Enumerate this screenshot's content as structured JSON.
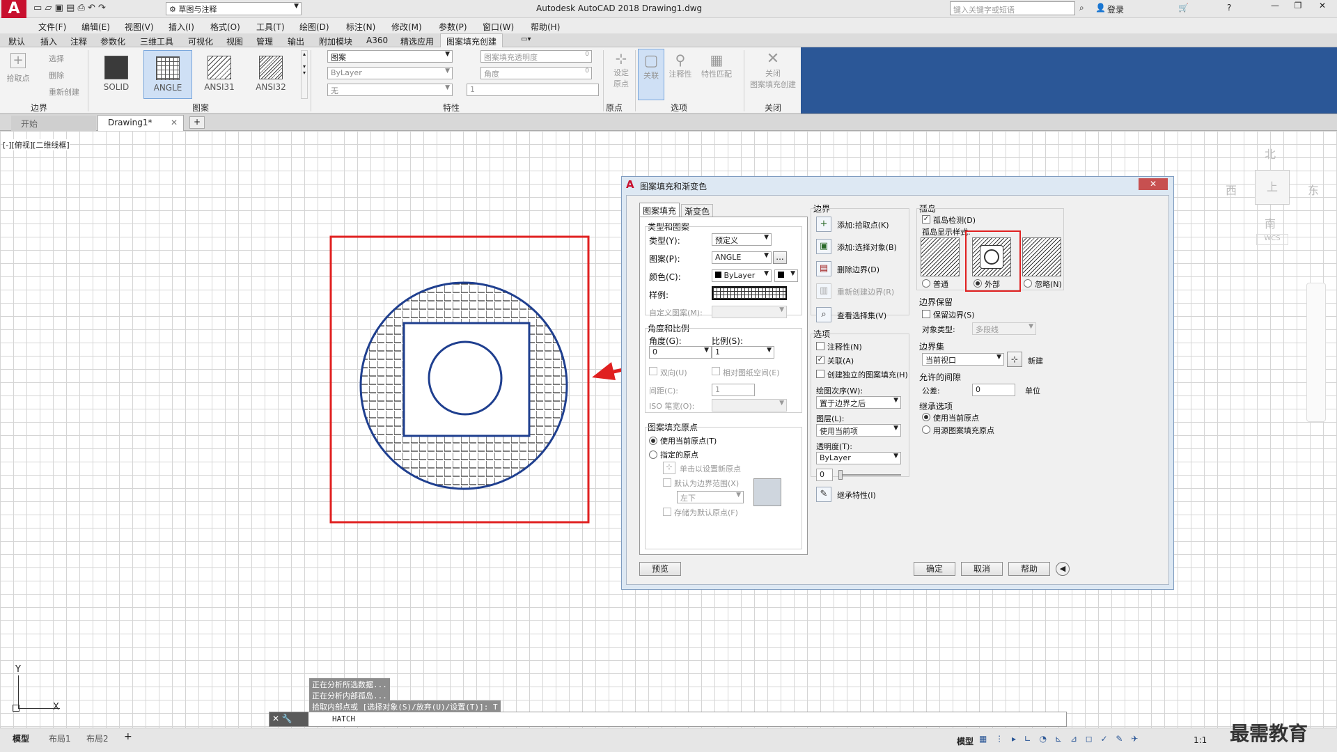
{
  "titlebar": {
    "workspace": "草图与注释",
    "title": "Autodesk AutoCAD 2018    Drawing1.dwg",
    "search_placeholder": "键入关键字或短语",
    "login": "登录"
  },
  "menu": [
    "文件(F)",
    "编辑(E)",
    "视图(V)",
    "插入(I)",
    "格式(O)",
    "工具(T)",
    "绘图(D)",
    "标注(N)",
    "修改(M)",
    "参数(P)",
    "窗口(W)",
    "帮助(H)"
  ],
  "ribbon_tabs": [
    "默认",
    "插入",
    "注释",
    "参数化",
    "三维工具",
    "可视化",
    "视图",
    "管理",
    "输出",
    "附加模块",
    "A360",
    "精选应用",
    "图案填充创建"
  ],
  "ribbon": {
    "boundary": {
      "pick": "拾取点",
      "select": "选择",
      "remove": "删除",
      "recreate": "重新创建",
      "label": "边界"
    },
    "patterns": {
      "items": [
        "SOLID",
        "ANGLE",
        "ANSI31",
        "ANSI32"
      ],
      "label": "图案"
    },
    "properties": {
      "pattern": "图案",
      "bylayer": "ByLayer",
      "none": "无",
      "transparency": "图案填充透明度",
      "transparency_val": "0",
      "angle": "角度",
      "angle_val": "0",
      "scale_val": "1",
      "label": "特性"
    },
    "origin": {
      "set": "设定\n原点",
      "label": "原点"
    },
    "options": {
      "assoc": "关联",
      "annot": "注释性",
      "match": "特性匹配",
      "label": "选项"
    },
    "close": {
      "btn": "关闭\n图案填充创建",
      "label": "关闭"
    }
  },
  "doc_tabs": {
    "start": "开始",
    "drawing": "Drawing1*"
  },
  "viewport_label": "[-][俯视][二维线框]",
  "viewcube": {
    "north": "北",
    "south": "南",
    "east": "东",
    "west": "西",
    "center": "上",
    "wcs": "WCS"
  },
  "dialog": {
    "title": "图案填充和渐变色",
    "tabs": [
      "图案填充",
      "渐变色"
    ],
    "type_pattern": "类型和图案",
    "type_label": "类型(Y):",
    "type_val": "预定义",
    "pattern_label": "图案(P):",
    "pattern_val": "ANGLE",
    "color_label": "颜色(C):",
    "color_val": "ByLayer",
    "sample_label": "样例:",
    "custom_label": "自定义图案(M):",
    "angle_scale": "角度和比例",
    "angle_label": "角度(G):",
    "angle_val": "0",
    "scale_label": "比例(S):",
    "scale_val": "1",
    "double": "双向(U)",
    "relative": "相对图纸空间(E)",
    "spacing_label": "间距(C):",
    "spacing_val": "1",
    "iso_label": "ISO 笔宽(O):",
    "origin_group": "图案填充原点",
    "use_current": "使用当前原点(T)",
    "specified": "指定的原点",
    "click_set": "单击以设置新原点",
    "default_extent": "默认为边界范围(X)",
    "lower_left": "左下",
    "store_default": "存储为默认原点(F)",
    "boundary_group": "边界",
    "add_pick": "添加:拾取点(K)",
    "add_select": "添加:选择对象(B)",
    "remove_boundary": "删除边界(D)",
    "recreate_boundary": "重新创建边界(R)",
    "view_selection": "查看选择集(V)",
    "options_group": "选项",
    "annotative": "注释性(N)",
    "associative": "关联(A)",
    "create_separate": "创建独立的图案填充(H)",
    "draw_order_label": "绘图次序(W):",
    "draw_order_val": "置于边界之后",
    "layer_label": "图层(L):",
    "layer_val": "使用当前项",
    "transparency_label": "透明度(T):",
    "transparency_val": "ByLayer",
    "transparency_num": "0",
    "inherit": "继承特性(I)",
    "islands_group": "孤岛",
    "island_detect": "孤岛检测(D)",
    "island_style": "孤岛显示样式:",
    "normal": "普通",
    "outer": "外部",
    "ignore": "忽略(N)",
    "boundary_retention": "边界保留",
    "retain_boundaries": "保留边界(S)",
    "object_type_label": "对象类型:",
    "object_type_val": "多段线",
    "boundary_set": "边界集",
    "boundary_set_val": "当前视口",
    "new": "新建",
    "gap_tolerance": "允许的间隙",
    "tolerance_label": "公差:",
    "tolerance_val": "0",
    "units": "单位",
    "inherit_options": "继承选项",
    "use_current_origin": "使用当前原点",
    "use_source_origin": "用源图案填充原点",
    "preview": "预览",
    "ok": "确定",
    "cancel": "取消",
    "help": "帮助"
  },
  "command_history": [
    "正在分析所选数据...",
    "正在分析内部孤岛...",
    "拾取内部点或 [选择对象(S)/放弃(U)/设置(T)]: T"
  ],
  "command_input": "HATCH",
  "layout_tabs": [
    "模型",
    "布局1",
    "布局2"
  ],
  "status": {
    "model": "模型",
    "scale": "1:1"
  },
  "watermark": "最需教育",
  "colors": {
    "highlight_red": "#e02020",
    "ribbon_accent": "#2b5797",
    "drawing_blue": "#1f3f8f"
  }
}
